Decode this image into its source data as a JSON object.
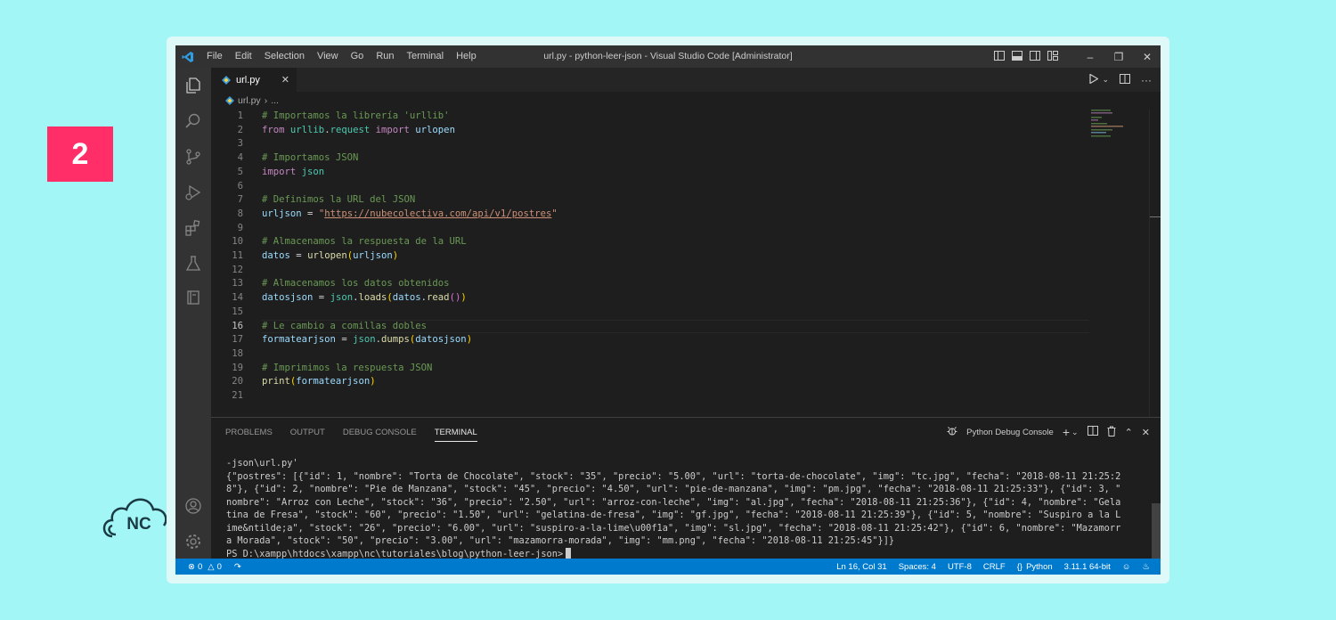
{
  "badge": "2",
  "logo_text": "NC",
  "titlebar": {
    "menu": [
      "File",
      "Edit",
      "Selection",
      "View",
      "Go",
      "Run",
      "Terminal",
      "Help"
    ],
    "window_title": "url.py - python-leer-json - Visual Studio Code [Administrator]"
  },
  "activity": [
    "explorer-icon",
    "search-icon",
    "source-control-icon",
    "run-debug-icon",
    "extensions-icon",
    "testing-icon",
    "notebook-icon",
    "account-icon",
    "settings-gear-icon"
  ],
  "tab": {
    "label": "url.py"
  },
  "breadcrumb": {
    "file": "url.py",
    "rest": "..."
  },
  "code": {
    "lines": [
      "# Importamos la librería 'urllib'",
      "from urllib.request import urlopen",
      "",
      "# Importamos JSON",
      "import json",
      "",
      "# Definimos la URL del JSON",
      "urljson = \"https://nubecolectiva.com/api/v1/postres\"",
      "",
      "# Almacenamos la respuesta de la URL",
      "datos = urlopen(urljson)",
      "",
      "# Almacenamos los datos obtenidos",
      "datosjson = json.loads(datos.read())",
      "",
      "# Le cambio a comillas dobles",
      "formatearjson = json.dumps(datosjson)",
      "",
      "# Imprimimos la respuesta JSON",
      "print(formatearjson)",
      ""
    ],
    "current_line": 16
  },
  "panel": {
    "tabs": [
      "PROBLEMS",
      "OUTPUT",
      "DEBUG CONSOLE",
      "TERMINAL"
    ],
    "active_tab": "TERMINAL",
    "debug_console_label": "Python Debug Console",
    "terminal_lines": [
      "-json\\url.py'",
      "{\"postres\": [{\"id\": 1, \"nombre\": \"Torta de Chocolate\", \"stock\": \"35\", \"precio\": \"5.00\", \"url\": \"torta-de-chocolate\", \"img\": \"tc.jpg\", \"fecha\": \"2018-08-11 21:25:2",
      "8\"}, {\"id\": 2, \"nombre\": \"Pie de Manzana\", \"stock\": \"45\", \"precio\": \"4.50\", \"url\": \"pie-de-manzana\", \"img\": \"pm.jpg\", \"fecha\": \"2018-08-11 21:25:33\"}, {\"id\": 3, \"",
      "nombre\": \"Arroz con Leche\", \"stock\": \"36\", \"precio\": \"2.50\", \"url\": \"arroz-con-leche\", \"img\": \"al.jpg\", \"fecha\": \"2018-08-11 21:25:36\"}, {\"id\": 4, \"nombre\": \"Gela",
      "tina de Fresa\", \"stock\": \"60\", \"precio\": \"1.50\", \"url\": \"gelatina-de-fresa\", \"img\": \"gf.jpg\", \"fecha\": \"2018-08-11 21:25:39\"}, {\"id\": 5, \"nombre\": \"Suspiro a la L",
      "ime&ntilde;a\", \"stock\": \"26\", \"precio\": \"6.00\", \"url\": \"suspiro-a-la-lime\\u00f1a\", \"img\": \"sl.jpg\", \"fecha\": \"2018-08-11 21:25:42\"}, {\"id\": 6, \"nombre\": \"Mazamorr",
      "a Morada\", \"stock\": \"50\", \"precio\": \"3.00\", \"url\": \"mazamorra-morada\", \"img\": \"mm.png\", \"fecha\": \"2018-08-11 21:25:45\"}]}"
    ],
    "prompt": "PS D:\\xampp\\htdocs\\xampp\\nc\\tutoriales\\blog\\python-leer-json>"
  },
  "status": {
    "errors": "0",
    "warnings": "0",
    "position": "Ln 16, Col 31",
    "spaces": "Spaces: 4",
    "encoding": "UTF-8",
    "eol": "CRLF",
    "language": "Python",
    "interpreter": "3.11.1 64-bit"
  },
  "colors": {
    "accent": "#007acc",
    "badge": "#ff2d68",
    "background": "#a3f6f6"
  }
}
